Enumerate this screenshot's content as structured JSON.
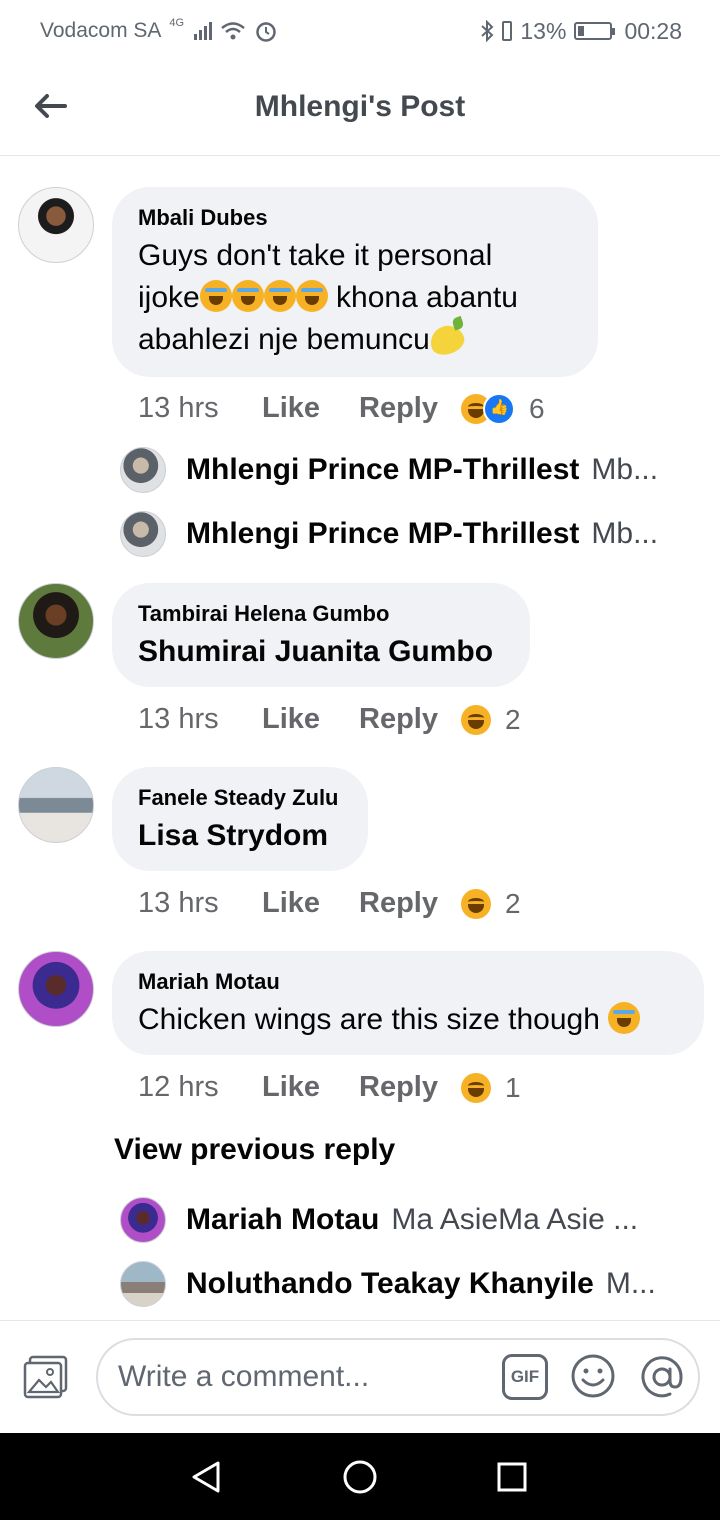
{
  "status_bar": {
    "carrier": "Vodacom SA",
    "network": "4G",
    "battery_percent": "13%",
    "time": "00:28"
  },
  "header": {
    "title": "Mhlengi's Post"
  },
  "comments": [
    {
      "author": "Mbali Dubes",
      "text_parts": [
        "Guys don't take it personal",
        "ijoke",
        "khona abantu",
        "abahlezi nje bemuncu"
      ],
      "time": "13 hrs",
      "like": "Like",
      "reply": "Reply",
      "reaction_count": "6",
      "replies": [
        {
          "name": "Mhlengi Prince MP-Thrillest",
          "snippet": "Mb..."
        },
        {
          "name": "Mhlengi Prince MP-Thrillest",
          "snippet": "Mb..."
        }
      ]
    },
    {
      "author": "Tambirai Helena Gumbo",
      "text": "Shumirai Juanita Gumbo",
      "time": "13 hrs",
      "like": "Like",
      "reply": "Reply",
      "reaction_count": "2"
    },
    {
      "author": "Fanele Steady Zulu",
      "text": "Lisa Strydom",
      "time": "13 hrs",
      "like": "Like",
      "reply": "Reply",
      "reaction_count": "2"
    },
    {
      "author": "Mariah Motau",
      "text": "Chicken wings are this size though",
      "time": "12 hrs",
      "like": "Like",
      "reply": "Reply",
      "reaction_count": "1",
      "view_previous": "View previous reply",
      "replies": [
        {
          "name": "Mariah Motau",
          "snippet": "Ma AsieMa Asie ..."
        },
        {
          "name": "Noluthando Teakay Khanyile",
          "snippet": "M..."
        }
      ]
    }
  ],
  "composer": {
    "placeholder": "Write a comment...",
    "gif_label": "GIF"
  },
  "colors": {
    "bubble": "#f0f2f5",
    "muted_text": "#65676b",
    "like_blue": "#1877f2",
    "haha_yellow": "#f7b125"
  },
  "icons": [
    "back-arrow-icon",
    "photo-icon",
    "gif-icon",
    "emoji-icon",
    "mention-icon",
    "nav-back-icon",
    "nav-home-icon",
    "nav-recents-icon"
  ]
}
